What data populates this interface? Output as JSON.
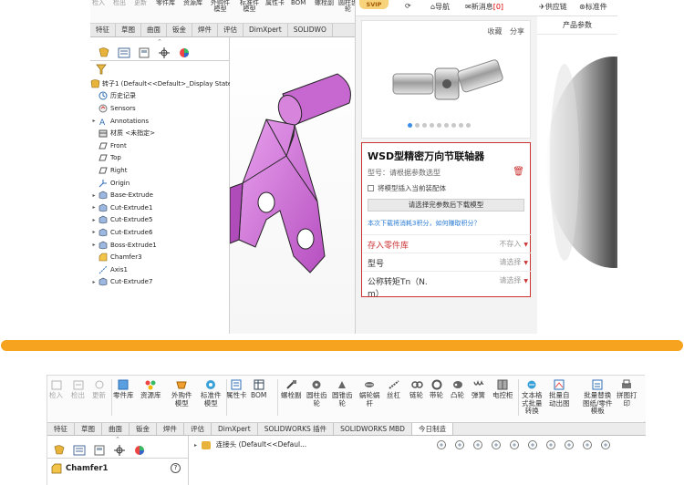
{
  "top_left": {
    "ribbon": [
      {
        "label": "检入",
        "dim": true
      },
      {
        "label": "检出",
        "dim": true
      },
      {
        "label": "更新",
        "dim": true
      },
      {
        "label": "零件库",
        "dim": false
      },
      {
        "label": "资源库",
        "dim": false
      },
      {
        "label": "外购件\n模型",
        "dim": false
      },
      {
        "label": "标准件\n模型",
        "dim": false
      },
      {
        "label": "属性卡",
        "dim": false
      },
      {
        "label": "BOM",
        "dim": false
      },
      {
        "label": "螺栓副",
        "dim": false
      },
      {
        "label": "圆柱齿\n轮",
        "dim": false
      }
    ],
    "tabs": [
      "特征",
      "草图",
      "曲面",
      "钣金",
      "焊件",
      "评估",
      "DimXpert",
      "SOLIDWO"
    ],
    "tree": [
      {
        "label": "转子1  (Default<<Default>_Display State 1>",
        "arrow": "",
        "icon": "part"
      },
      {
        "label": "历史记录",
        "arrow": "",
        "icon": "history"
      },
      {
        "label": "Sensors",
        "arrow": "",
        "icon": "sensor"
      },
      {
        "label": "Annotations",
        "arrow": "▸",
        "icon": "annot"
      },
      {
        "label": "材质 <未指定>",
        "arrow": "",
        "icon": "material"
      },
      {
        "label": "Front",
        "arrow": "",
        "icon": "plane"
      },
      {
        "label": "Top",
        "arrow": "",
        "icon": "plane"
      },
      {
        "label": "Right",
        "arrow": "",
        "icon": "plane"
      },
      {
        "label": "Origin",
        "arrow": "",
        "icon": "origin"
      },
      {
        "label": "Base-Extrude",
        "arrow": "▸",
        "icon": "feature"
      },
      {
        "label": "Cut-Extrude1",
        "arrow": "▸",
        "icon": "feature"
      },
      {
        "label": "Cut-Extrude5",
        "arrow": "▸",
        "icon": "feature"
      },
      {
        "label": "Cut-Extrude6",
        "arrow": "▸",
        "icon": "feature"
      },
      {
        "label": "Boss-Extrude1",
        "arrow": "▸",
        "icon": "feature"
      },
      {
        "label": "Chamfer3",
        "arrow": "",
        "icon": "chamfer"
      },
      {
        "label": "Axis1",
        "arrow": "",
        "icon": "axis"
      },
      {
        "label": "Cut-Extrude7",
        "arrow": "▸",
        "icon": "feature"
      }
    ]
  },
  "shop": {
    "svip": "SVIP",
    "nav_guide": "导航",
    "nav_msg": "新消息",
    "nav_msg_count": "[0]",
    "nav_supply": "供应链",
    "nav_std": "标准件",
    "actions_fav": "收藏",
    "actions_share": "分享",
    "dot_count": 9,
    "title": "WSD型精密万向节联轴器",
    "model_hint": "型号：请根据参数选型",
    "insert_label": "将模型插入当前装配体",
    "download_btn": "请选择完参数后下载模型",
    "points_note": "本次下载将消耗3积分，如何赚取积分？",
    "rows": [
      {
        "label": "存入零件库",
        "value": "不存入",
        "red": true
      },
      {
        "label": "型号",
        "value": "请选择",
        "red": false
      },
      {
        "label": "公称转矩Tn（N.\nm）",
        "value": "请选择",
        "red": false
      }
    ],
    "params_tab": "产品参数"
  },
  "bottom": {
    "ribbon": [
      {
        "label": "检入",
        "dim": true,
        "icon": "check-in"
      },
      {
        "label": "检出",
        "dim": true,
        "icon": "check-out"
      },
      {
        "label": "更新",
        "dim": true,
        "icon": "update"
      },
      {
        "label": "零件库",
        "dim": false,
        "icon": "part-lib"
      },
      {
        "label": "资源库",
        "dim": false,
        "icon": "res-lib"
      },
      {
        "label": "外购件\n模型",
        "dim": false,
        "icon": "purchase"
      },
      {
        "label": "标准件\n模型",
        "dim": false,
        "icon": "std"
      },
      {
        "label": "属性卡",
        "dim": false,
        "icon": "card"
      },
      {
        "label": "BOM",
        "dim": false,
        "icon": "bom"
      },
      {
        "label": "螺栓副",
        "dim": false,
        "icon": "bolt"
      },
      {
        "label": "圆柱齿\n轮",
        "dim": false,
        "icon": "gear1"
      },
      {
        "label": "圆锥齿\n轮",
        "dim": false,
        "icon": "gear2"
      },
      {
        "label": "蜗轮蜗\n杆",
        "dim": false,
        "icon": "worm"
      },
      {
        "label": "丝杠",
        "dim": false,
        "icon": "screw"
      },
      {
        "label": "链轮",
        "dim": false,
        "icon": "chain"
      },
      {
        "label": "带轮",
        "dim": false,
        "icon": "belt"
      },
      {
        "label": "凸轮",
        "dim": false,
        "icon": "cam"
      },
      {
        "label": "弹簧",
        "dim": false,
        "icon": "spring"
      },
      {
        "label": "电控柜",
        "dim": false,
        "icon": "cabinet"
      },
      {
        "label": "文本格\n式批量\n转换",
        "dim": false,
        "icon": "convert"
      },
      {
        "label": "批量自\n动出图",
        "dim": false,
        "icon": "drawing"
      },
      {
        "label": "批量替换\n图纸/零件\n模板",
        "dim": false,
        "icon": "replace"
      },
      {
        "label": "拼图打\n印",
        "dim": false,
        "icon": "print"
      }
    ],
    "tabs": [
      "特征",
      "草图",
      "曲面",
      "钣金",
      "焊件",
      "评估",
      "DimXpert",
      "SOLIDWORKS 插件",
      "SOLIDWORKS MBD",
      "今日制造"
    ],
    "tree_item": "连接头  (Default<<Defaul...",
    "prop_title": "Chamfer1",
    "help": "?"
  },
  "colors": {
    "accent_orange": "#f6a320",
    "part_purple": "#d47ddb",
    "red": "#cc3333",
    "link_blue": "#2a7bd4"
  }
}
